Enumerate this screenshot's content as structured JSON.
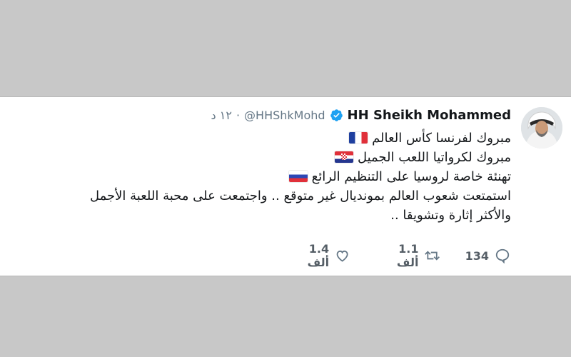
{
  "tweet": {
    "author_name": "HH Sheikh Mohammed",
    "handle": "@HHShkMohd",
    "separator": "·",
    "time": "١٢ د",
    "lines": [
      {
        "text": "مبروك لفرنسا كأس العالم",
        "flag": "fr"
      },
      {
        "text": "مبروك لكرواتيا اللعب الجميل",
        "flag": "hr"
      },
      {
        "text": "تهنئة خاصة لروسيا على التنظيم الرائع",
        "flag": "ru"
      },
      {
        "text": "استمتعت شعوب العالم بمونديال غير متوقع  .. واجتمعت على محبة اللعبة الأجمل",
        "flag": ""
      },
      {
        "text": "والأكثر إثارة وتشويقا ..",
        "flag": ""
      }
    ],
    "actions": {
      "reply_count": "134",
      "retweet_count": "1.1 ألف",
      "like_count": "1.4 ألف"
    },
    "icons": {
      "verified": "verified-badge-icon",
      "reply": "reply-icon",
      "retweet": "retweet-icon",
      "like": "heart-icon"
    },
    "colors": {
      "verified": "#1da1f2",
      "meta_text": "#657786",
      "text": "#14171a",
      "background": "#c8c8c8"
    }
  }
}
